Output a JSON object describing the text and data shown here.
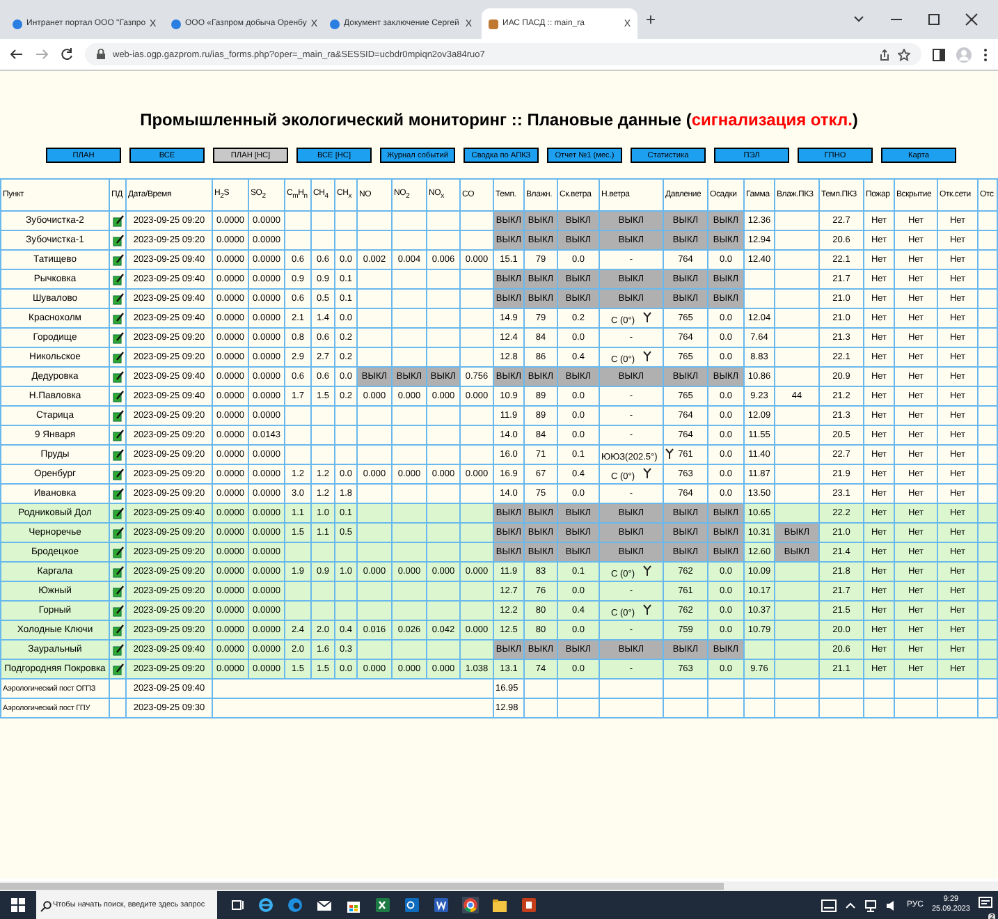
{
  "browser": {
    "tabs": [
      {
        "title": "Интранет портал ООО \"Газпро",
        "selected": false,
        "close": "X"
      },
      {
        "title": "ООО «Газпром добыча Оренбу",
        "selected": false,
        "close": "X"
      },
      {
        "title": "Документ заключение Сергей",
        "selected": false,
        "close": "X"
      },
      {
        "title": "ИАС ПАСД :: main_ra",
        "selected": true,
        "close": "X"
      }
    ],
    "new_tab": "+",
    "url": "web-ias.ogp.gazprom.ru/ias_forms.php?oper=_main_ra&SESSID=ucbdr0mpiqn2ov3a84ruo7"
  },
  "title": {
    "main": "Промышленный экологический мониторинг :: Плановые данные (",
    "alert": "сигнализация откл.",
    "close": ")"
  },
  "nav_buttons": [
    {
      "label": "ПЛАН",
      "selected": false
    },
    {
      "label": "ВСЕ",
      "selected": false
    },
    {
      "label": "ПЛАН [НС]",
      "selected": true
    },
    {
      "label": "ВСЕ [НС]",
      "selected": false
    },
    {
      "label": "Журнал событий",
      "selected": false
    },
    {
      "label": "Сводка по АПКЗ",
      "selected": false
    },
    {
      "label": "Отчет №1 (мес.)",
      "selected": false
    },
    {
      "label": "Статистика",
      "selected": false
    },
    {
      "label": "ПЭЛ",
      "selected": false
    },
    {
      "label": "ГПНО",
      "selected": false
    },
    {
      "label": "Карта",
      "selected": false
    }
  ],
  "table": {
    "columns": [
      "Пункт",
      "ПД",
      "Дата/Время",
      "H$_{2}$S",
      "SO$_{2}$",
      "C$_{m}$H$_{n}$",
      "CH$_{4}$",
      "CH$_{x}$",
      "NO",
      "NO$_{2}$",
      "NO$_{x}$",
      "CO",
      "Темп.",
      "Влажн.",
      "Ск.ветра",
      "Н.ветра",
      "Давление",
      "Осадки",
      "Гамма",
      "Влаж.ПКЗ",
      "Темп.ПКЗ",
      "Пожар",
      "Вскрытие",
      "Отк.сети",
      "Отс"
    ],
    "rows": [
      {
        "kind": "station",
        "name": "Зубочистка-2",
        "date": "2023-09-25 09:20",
        "highlighted": false,
        "gas_off": false,
        "meteo_off": true,
        "pkz_off": false,
        "wind_arrow": false,
        "cells": [
          "0.0000",
          "0.0000",
          null,
          null,
          null,
          null,
          null,
          null,
          null,
          "ВЫКЛ",
          "ВЫКЛ",
          "ВЫКЛ",
          "ВЫКЛ",
          "ВЫКЛ",
          "ВЫКЛ",
          "12.36",
          null,
          "22.7",
          "Нет",
          "Нет",
          "Нет"
        ]
      },
      {
        "kind": "station",
        "name": "Зубочистка-1",
        "date": "2023-09-25 09:20",
        "highlighted": false,
        "gas_off": false,
        "meteo_off": true,
        "pkz_off": false,
        "wind_arrow": false,
        "cells": [
          "0.0000",
          "0.0000",
          null,
          null,
          null,
          null,
          null,
          null,
          null,
          "ВЫКЛ",
          "ВЫКЛ",
          "ВЫКЛ",
          "ВЫКЛ",
          "ВЫКЛ",
          "ВЫКЛ",
          "12.94",
          null,
          "20.6",
          "Нет",
          "Нет",
          "Нет"
        ]
      },
      {
        "kind": "station",
        "name": "Татищево",
        "date": "2023-09-25 09:40",
        "highlighted": false,
        "gas_off": false,
        "meteo_off": false,
        "pkz_off": false,
        "wind_arrow": false,
        "cells": [
          "0.0000",
          "0.0000",
          "0.6",
          "0.6",
          "0.0",
          "0.002",
          "0.004",
          "0.006",
          "0.000",
          "15.1",
          "79",
          "0.0",
          "-",
          "764",
          "0.0",
          "12.40",
          null,
          "22.1",
          "Нет",
          "Нет",
          "Нет"
        ]
      },
      {
        "kind": "station",
        "name": "Рычковка",
        "date": "2023-09-25 09:40",
        "highlighted": false,
        "gas_off": false,
        "meteo_off": true,
        "pkz_off": false,
        "wind_arrow": false,
        "cells": [
          "0.0000",
          "0.0000",
          "0.9",
          "0.9",
          "0.1",
          null,
          null,
          null,
          null,
          "ВЫКЛ",
          "ВЫКЛ",
          "ВЫКЛ",
          "ВЫКЛ",
          "ВЫКЛ",
          "ВЫКЛ",
          null,
          null,
          "21.7",
          "Нет",
          "Нет",
          "Нет"
        ]
      },
      {
        "kind": "station",
        "name": "Шувалово",
        "date": "2023-09-25 09:40",
        "highlighted": false,
        "gas_off": false,
        "meteo_off": true,
        "pkz_off": false,
        "wind_arrow": false,
        "cells": [
          "0.0000",
          "0.0000",
          "0.6",
          "0.5",
          "0.1",
          null,
          null,
          null,
          null,
          "ВЫКЛ",
          "ВЫКЛ",
          "ВЫКЛ",
          "ВЫКЛ",
          "ВЫКЛ",
          "ВЫКЛ",
          null,
          null,
          "21.0",
          "Нет",
          "Нет",
          "Нет"
        ]
      },
      {
        "kind": "station",
        "name": "Краснохолм",
        "date": "2023-09-25 09:40",
        "highlighted": false,
        "gas_off": false,
        "meteo_off": false,
        "pkz_off": false,
        "wind_arrow": true,
        "cells": [
          "0.0000",
          "0.0000",
          "2.1",
          "1.4",
          "0.0",
          null,
          null,
          null,
          null,
          "14.9",
          "79",
          "0.2",
          "С (0°)",
          "765",
          "0.0",
          "12.04",
          null,
          "21.0",
          "Нет",
          "Нет",
          "Нет"
        ]
      },
      {
        "kind": "station",
        "name": "Городище",
        "date": "2023-09-25 09:20",
        "highlighted": false,
        "gas_off": false,
        "meteo_off": false,
        "pkz_off": false,
        "wind_arrow": false,
        "cells": [
          "0.0000",
          "0.0000",
          "0.8",
          "0.6",
          "0.2",
          null,
          null,
          null,
          null,
          "12.4",
          "84",
          "0.0",
          "-",
          "764",
          "0.0",
          "7.64",
          null,
          "21.3",
          "Нет",
          "Нет",
          "Нет"
        ]
      },
      {
        "kind": "station",
        "name": "Никольское",
        "date": "2023-09-25 09:20",
        "highlighted": false,
        "gas_off": false,
        "meteo_off": false,
        "pkz_off": false,
        "wind_arrow": true,
        "cells": [
          "0.0000",
          "0.0000",
          "2.9",
          "2.7",
          "0.2",
          null,
          null,
          null,
          null,
          "12.8",
          "86",
          "0.4",
          "С (0°)",
          "765",
          "0.0",
          "8.83",
          null,
          "22.1",
          "Нет",
          "Нет",
          "Нет"
        ]
      },
      {
        "kind": "station",
        "name": "Дедуровка",
        "date": "2023-09-25 09:40",
        "highlighted": false,
        "gas_off": true,
        "meteo_off": true,
        "pkz_off": false,
        "wind_arrow": false,
        "cells": [
          "0.0000",
          "0.0000",
          "0.6",
          "0.6",
          "0.0",
          "ВЫКЛ",
          "ВЫКЛ",
          "ВЫКЛ",
          "0.756",
          "ВЫКЛ",
          "ВЫКЛ",
          "ВЫКЛ",
          "ВЫКЛ",
          "ВЫКЛ",
          "ВЫКЛ",
          "10.86",
          null,
          "20.9",
          "Нет",
          "Нет",
          "Нет"
        ]
      },
      {
        "kind": "station",
        "name": "Н.Павловка",
        "date": "2023-09-25 09:40",
        "highlighted": false,
        "gas_off": false,
        "meteo_off": false,
        "pkz_off": false,
        "wind_arrow": false,
        "cells": [
          "0.0000",
          "0.0000",
          "1.7",
          "1.5",
          "0.2",
          "0.000",
          "0.000",
          "0.000",
          "0.000",
          "10.9",
          "89",
          "0.0",
          "-",
          "765",
          "0.0",
          "9.23",
          "44",
          "21.2",
          "Нет",
          "Нет",
          "Нет"
        ]
      },
      {
        "kind": "station",
        "name": "Старица",
        "date": "2023-09-25 09:20",
        "highlighted": false,
        "gas_off": false,
        "meteo_off": false,
        "pkz_off": false,
        "wind_arrow": false,
        "cells": [
          "0.0000",
          "0.0000",
          null,
          null,
          null,
          null,
          null,
          null,
          null,
          "11.9",
          "89",
          "0.0",
          "-",
          "764",
          "0.0",
          "12.09",
          null,
          "21.3",
          "Нет",
          "Нет",
          "Нет"
        ]
      },
      {
        "kind": "station",
        "name": "9 Января",
        "date": "2023-09-25 09:20",
        "highlighted": false,
        "gas_off": false,
        "meteo_off": false,
        "pkz_off": false,
        "wind_arrow": false,
        "cells": [
          "0.0000",
          "0.0143",
          null,
          null,
          null,
          null,
          null,
          null,
          null,
          "14.0",
          "84",
          "0.0",
          "-",
          "764",
          "0.0",
          "11.55",
          null,
          "20.5",
          "Нет",
          "Нет",
          "Нет"
        ]
      },
      {
        "kind": "station",
        "name": "Пруды",
        "date": "2023-09-25 09:20",
        "highlighted": false,
        "gas_off": false,
        "meteo_off": false,
        "pkz_off": false,
        "wind_arrow": true,
        "cells": [
          "0.0000",
          "0.0000",
          null,
          null,
          null,
          null,
          null,
          null,
          null,
          "16.0",
          "71",
          "0.1",
          "ЮЮЗ(202.5°)",
          "761",
          "0.0",
          "11.40",
          null,
          "22.7",
          "Нет",
          "Нет",
          "Нет"
        ]
      },
      {
        "kind": "station",
        "name": "Оренбург",
        "date": "2023-09-25 09:20",
        "highlighted": false,
        "gas_off": false,
        "meteo_off": false,
        "pkz_off": false,
        "wind_arrow": true,
        "cells": [
          "0.0000",
          "0.0000",
          "1.2",
          "1.2",
          "0.0",
          "0.000",
          "0.000",
          "0.000",
          "0.000",
          "16.9",
          "67",
          "0.4",
          "С (0°)",
          "763",
          "0.0",
          "11.87",
          null,
          "21.9",
          "Нет",
          "Нет",
          "Нет"
        ]
      },
      {
        "kind": "station",
        "name": "Ивановка",
        "date": "2023-09-25 09:20",
        "highlighted": false,
        "gas_off": false,
        "meteo_off": false,
        "pkz_off": false,
        "wind_arrow": false,
        "cells": [
          "0.0000",
          "0.0000",
          "3.0",
          "1.2",
          "1.8",
          null,
          null,
          null,
          null,
          "14.0",
          "75",
          "0.0",
          "-",
          "764",
          "0.0",
          "13.50",
          null,
          "23.1",
          "Нет",
          "Нет",
          "Нет"
        ]
      },
      {
        "kind": "station",
        "name": "Родниковый Дол",
        "date": "2023-09-25 09:40",
        "highlighted": true,
        "gas_off": false,
        "meteo_off": true,
        "pkz_off": false,
        "wind_arrow": false,
        "cells": [
          "0.0000",
          "0.0000",
          "1.1",
          "1.0",
          "0.1",
          null,
          null,
          null,
          null,
          "ВЫКЛ",
          "ВЫКЛ",
          "ВЫКЛ",
          "ВЫКЛ",
          "ВЫКЛ",
          "ВЫКЛ",
          "10.65",
          null,
          "22.2",
          "Нет",
          "Нет",
          "Нет"
        ]
      },
      {
        "kind": "station",
        "name": "Черноречье",
        "date": "2023-09-25 09:20",
        "highlighted": true,
        "gas_off": false,
        "meteo_off": true,
        "pkz_off": true,
        "wind_arrow": false,
        "cells": [
          "0.0000",
          "0.0000",
          "1.5",
          "1.1",
          "0.5",
          null,
          null,
          null,
          null,
          "ВЫКЛ",
          "ВЫКЛ",
          "ВЫКЛ",
          "ВЫКЛ",
          "ВЫКЛ",
          "ВЫКЛ",
          "10.31",
          "ВЫКЛ",
          "21.0",
          "Нет",
          "Нет",
          "Нет"
        ]
      },
      {
        "kind": "station",
        "name": "Бродецкое",
        "date": "2023-09-25 09:20",
        "highlighted": true,
        "gas_off": false,
        "meteo_off": true,
        "pkz_off": true,
        "wind_arrow": false,
        "cells": [
          "0.0000",
          "0.0000",
          null,
          null,
          null,
          null,
          null,
          null,
          null,
          "ВЫКЛ",
          "ВЫКЛ",
          "ВЫКЛ",
          "ВЫКЛ",
          "ВЫКЛ",
          "ВЫКЛ",
          "12.60",
          "ВЫКЛ",
          "21.4",
          "Нет",
          "Нет",
          "Нет"
        ]
      },
      {
        "kind": "station",
        "name": "Каргала",
        "date": "2023-09-25 09:20",
        "highlighted": true,
        "gas_off": false,
        "meteo_off": false,
        "pkz_off": false,
        "wind_arrow": true,
        "cells": [
          "0.0000",
          "0.0000",
          "1.9",
          "0.9",
          "1.0",
          "0.000",
          "0.000",
          "0.000",
          "0.000",
          "11.9",
          "83",
          "0.1",
          "С (0°)",
          "762",
          "0.0",
          "10.09",
          null,
          "21.8",
          "Нет",
          "Нет",
          "Нет"
        ]
      },
      {
        "kind": "station",
        "name": "Южный",
        "date": "2023-09-25 09:20",
        "highlighted": true,
        "gas_off": false,
        "meteo_off": false,
        "pkz_off": false,
        "wind_arrow": false,
        "cells": [
          "0.0000",
          "0.0000",
          null,
          null,
          null,
          null,
          null,
          null,
          null,
          "12.7",
          "76",
          "0.0",
          "-",
          "761",
          "0.0",
          "10.17",
          null,
          "21.7",
          "Нет",
          "Нет",
          "Нет"
        ]
      },
      {
        "kind": "station",
        "name": "Горный",
        "date": "2023-09-25 09:20",
        "highlighted": true,
        "gas_off": false,
        "meteo_off": false,
        "pkz_off": false,
        "wind_arrow": true,
        "cells": [
          "0.0000",
          "0.0000",
          null,
          null,
          null,
          null,
          null,
          null,
          null,
          "12.2",
          "80",
          "0.4",
          "С (0°)",
          "762",
          "0.0",
          "10.37",
          null,
          "21.5",
          "Нет",
          "Нет",
          "Нет"
        ]
      },
      {
        "kind": "station",
        "name": "Холодные Ключи",
        "date": "2023-09-25 09:20",
        "highlighted": true,
        "gas_off": false,
        "meteo_off": false,
        "pkz_off": false,
        "wind_arrow": false,
        "cells": [
          "0.0000",
          "0.0000",
          "2.4",
          "2.0",
          "0.4",
          "0.016",
          "0.026",
          "0.042",
          "0.000",
          "12.5",
          "80",
          "0.0",
          "-",
          "759",
          "0.0",
          "10.79",
          null,
          "20.0",
          "Нет",
          "Нет",
          "Нет"
        ]
      },
      {
        "kind": "station",
        "name": "Зауральный",
        "date": "2023-09-25 09:40",
        "highlighted": true,
        "gas_off": false,
        "meteo_off": true,
        "pkz_off": false,
        "wind_arrow": false,
        "cells": [
          "0.0000",
          "0.0000",
          "2.0",
          "1.6",
          "0.3",
          null,
          null,
          null,
          null,
          "ВЫКЛ",
          "ВЫКЛ",
          "ВЫКЛ",
          "ВЫКЛ",
          "ВЫКЛ",
          "ВЫКЛ",
          null,
          null,
          "20.6",
          "Нет",
          "Нет",
          "Нет"
        ]
      },
      {
        "kind": "station",
        "name": "Подгородняя Покровка",
        "date": "2023-09-25 09:20",
        "highlighted": true,
        "gas_off": false,
        "meteo_off": false,
        "pkz_off": false,
        "wind_arrow": false,
        "cells": [
          "0.0000",
          "0.0000",
          "1.5",
          "1.5",
          "0.0",
          "0.000",
          "0.000",
          "0.000",
          "1.038",
          "13.1",
          "74",
          "0.0",
          "-",
          "763",
          "0.0",
          "9.76",
          null,
          "21.1",
          "Нет",
          "Нет",
          "Нет"
        ]
      },
      {
        "kind": "aero",
        "name": "Аэрологический пост ОГПЗ",
        "date": "2023-09-25 09:40",
        "temp": "16.95"
      },
      {
        "kind": "aero",
        "name": "Аэрологический пост ГПУ",
        "date": "2023-09-25 09:30",
        "temp": "12.98"
      }
    ]
  },
  "taskbar": {
    "search_placeholder": "Чтобы начать поиск, введите здесь запрос",
    "language": "РУС",
    "time": "9:29",
    "date": "25.09.2023",
    "notifications": "2"
  }
}
